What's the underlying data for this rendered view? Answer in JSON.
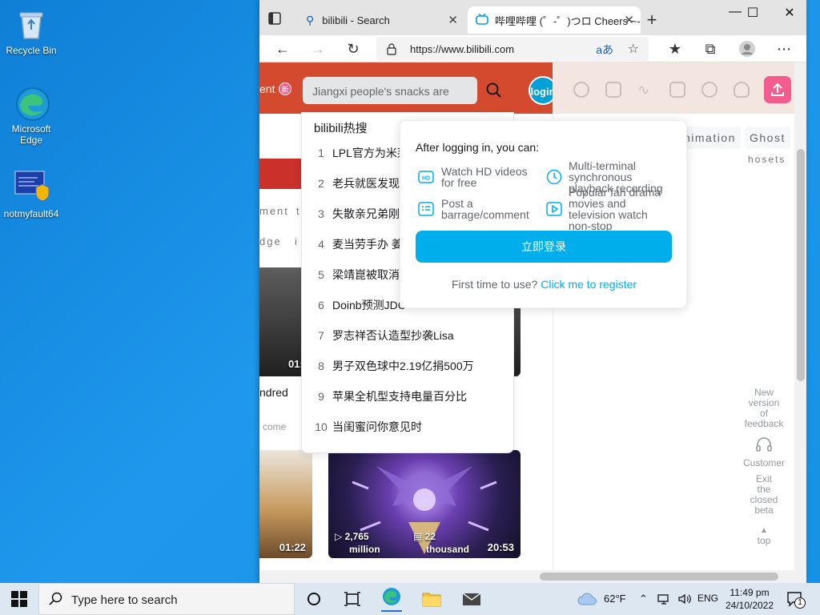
{
  "desktop": {
    "icons": [
      {
        "label": "Recycle Bin"
      },
      {
        "label": "Microsoft Edge"
      },
      {
        "label": "notmyfault64"
      }
    ]
  },
  "browser": {
    "tabs": [
      {
        "title": "bilibili - Search"
      },
      {
        "title": "哔哩哔哩 (゜-゜)つロ Cheers ~-"
      }
    ],
    "address": {
      "url": "https://www.bilibili.com"
    }
  },
  "page": {
    "header": {
      "ent_label": "ent",
      "new_badge": "新",
      "search_placeholder": "Jiangxi people's snacks are",
      "login_label": "login"
    },
    "hot_search": {
      "title": "bilibili热搜",
      "items": [
        {
          "rank": "1",
          "text": "LPL官方为米莱"
        },
        {
          "rank": "2",
          "text": "老兵就医发现"
        },
        {
          "rank": "3",
          "text": "失散亲兄弟刚"
        },
        {
          "rank": "4",
          "text": "麦当劳手办 姜"
        },
        {
          "rank": "5",
          "text": "梁靖崑被取消"
        },
        {
          "rank": "6",
          "text": "Doinb预测JDC"
        },
        {
          "rank": "7",
          "text": "罗志祥否认造型抄袭Lisa"
        },
        {
          "rank": "8",
          "text": "男子双色球中2.19亿捐500万"
        },
        {
          "rank": "9",
          "text": "苹果全机型支持电量百分比"
        },
        {
          "rank": "10",
          "text": "当闺蜜问你意见时"
        }
      ]
    },
    "login_popover": {
      "title": "After logging in, you can:",
      "features": [
        {
          "line1": "Watch HD videos",
          "line2": "for free"
        },
        {
          "line1": "Multi-terminal",
          "line2": "synchronous",
          "line3": "playback recording"
        },
        {
          "line1": "Post a",
          "line2": "barrage/comment"
        },
        {
          "line1": "Popular fan drama",
          "line2": "movies and",
          "line3": "television watch",
          "line4": "non-stop"
        }
      ],
      "cta": "立即登录",
      "register_prefix": "First time to use?",
      "register_link": "Click me to register"
    },
    "fragments": {
      "ment": "ment",
      "t": "t",
      "dge": "dge",
      "i": "i",
      "ndred": "ndred",
      "come": "come"
    },
    "category_chips": [
      "nimation",
      "Ghost"
    ],
    "chip_sub": "hosets",
    "videos": [
      {
        "duration": "01:4"
      },
      {
        "duration": "01:22"
      },
      {
        "views": "2,765",
        "views_unit": "million",
        "danmaku": "22",
        "danmaku_unit": "thousand",
        "duration": "20:53"
      }
    ],
    "side_links": {
      "feedback": [
        "New",
        "version",
        "of",
        "feedback"
      ],
      "customer": "Customer",
      "exit_beta": [
        "Exit",
        "the",
        "closed",
        "beta"
      ],
      "top": "top"
    }
  },
  "taskbar": {
    "search_placeholder": "Type here to search",
    "weather": "62°F",
    "language": "ENG",
    "time": "11:49 pm",
    "date": "24/10/2022",
    "notification_count": "1"
  }
}
